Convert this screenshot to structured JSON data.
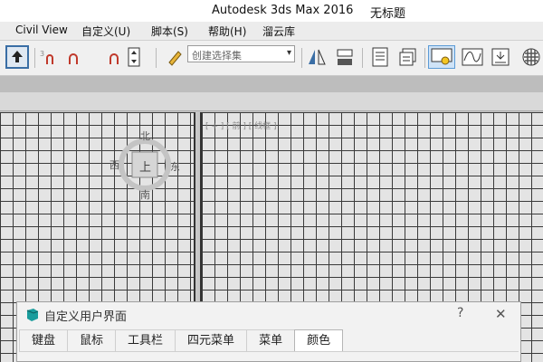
{
  "window": {
    "title": "Autodesk 3ds Max 2016",
    "doc_title": "无标题"
  },
  "menu": {
    "items": [
      "Civil View",
      "自定义(U)",
      "脚本(S)",
      "帮助(H)",
      "溜云库"
    ]
  },
  "toolbar": {
    "selection_set_placeholder": "创建选择集"
  },
  "viewport": {
    "label": "[ + ] [ 前 ] [ 线框 ]",
    "viewcube": {
      "face": "上",
      "north": "北",
      "south": "南",
      "east": "东",
      "west": "西"
    }
  },
  "dialog": {
    "title": "自定义用户界面",
    "help": "?",
    "close": "✕",
    "tabs": [
      "键盘",
      "鼠标",
      "工具栏",
      "四元菜单",
      "菜单",
      "颜色"
    ],
    "active_tab": "颜色"
  }
}
